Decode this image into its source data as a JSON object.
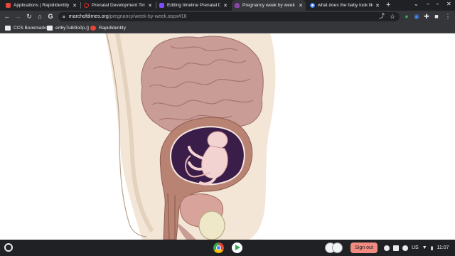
{
  "tabs": [
    {
      "title": "Applications | RapidIdentity",
      "favicon_color": "#e8453c",
      "active": false
    },
    {
      "title": "Prenatal Development Timeli",
      "favicon_color": "#d93025",
      "active": false
    },
    {
      "title": "Editing timeline Prenatal Deve",
      "favicon_color": "#7c4dff",
      "active": false
    },
    {
      "title": "Pregnancy week by week",
      "favicon_color": "#8e44ad",
      "active": true
    },
    {
      "title": "what does the baby look like i",
      "favicon_color": "#4285f4",
      "active": false
    }
  ],
  "toolbar": {
    "url_host": "marchofdimes.org",
    "url_path": "/pregnancy/week-by-week.aspx#16"
  },
  "bookmarks": [
    {
      "label": "CCS Bookmarks",
      "icon": "folder-icon",
      "color": "#e8eaed"
    },
    {
      "label": "ert6y7u8i9o0p-[]",
      "icon": "folder-icon",
      "color": "#e8eaed"
    },
    {
      "label": "RapidIdentity",
      "icon": "rapididentity-icon",
      "color": "#e8453c"
    }
  ],
  "shelf": {
    "sign_out_label": "Sign out",
    "locale": "US",
    "time": "11:07"
  },
  "colors": {
    "skin": "#f3e6d6",
    "organ": "#c99c96",
    "womb": "#b98373",
    "amnion": "#3b1d4a",
    "fetus": "#f2d3d2"
  }
}
